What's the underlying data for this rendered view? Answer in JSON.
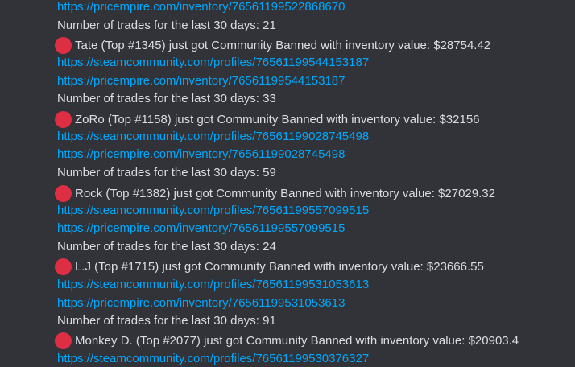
{
  "entries": [
    {
      "inventory_url": "https://pricempire.com/inventory/76561199522868670",
      "trades_text": "Number of trades for the last 30 days: 21"
    },
    {
      "emoji": "red-circle-icon",
      "ban_text": "Tate (Top #1345) just got Community Banned with inventory value: $28754.42",
      "profile_url": "https://steamcommunity.com/profiles/76561199544153187",
      "inventory_url": "https://pricempire.com/inventory/76561199544153187",
      "trades_text": "Number of trades for the last 30 days: 33"
    },
    {
      "emoji": "red-circle-icon",
      "ban_text": "ZoRo (Top #1158) just got Community Banned with inventory value: $32156",
      "profile_url": "https://steamcommunity.com/profiles/76561199028745498",
      "inventory_url": "https://pricempire.com/inventory/76561199028745498",
      "trades_text": "Number of trades for the last 30 days: 59"
    },
    {
      "emoji": "red-circle-icon",
      "ban_text": "Rock (Top #1382) just got Community Banned with inventory value: $27029.32",
      "profile_url": "https://steamcommunity.com/profiles/76561199557099515",
      "inventory_url": "https://pricempire.com/inventory/76561199557099515",
      "trades_text": "Number of trades for the last 30 days: 24"
    },
    {
      "emoji": "red-circle-icon",
      "ban_text": "L.J (Top #1715) just got Community Banned with inventory value: $23666.55",
      "profile_url": "https://steamcommunity.com/profiles/76561199531053613",
      "inventory_url": "https://pricempire.com/inventory/76561199531053613",
      "trades_text": "Number of trades for the last 30 days: 91"
    },
    {
      "emoji": "red-circle-icon",
      "ban_text": "Monkey D. (Top #2077) just got Community Banned with inventory value: $20903.4",
      "profile_url": "https://steamcommunity.com/profiles/76561199530376327"
    }
  ],
  "colors": {
    "background": "#313338",
    "text": "#dbdee1",
    "link": "#00a8fc",
    "red_circle": "#dd2e44"
  }
}
